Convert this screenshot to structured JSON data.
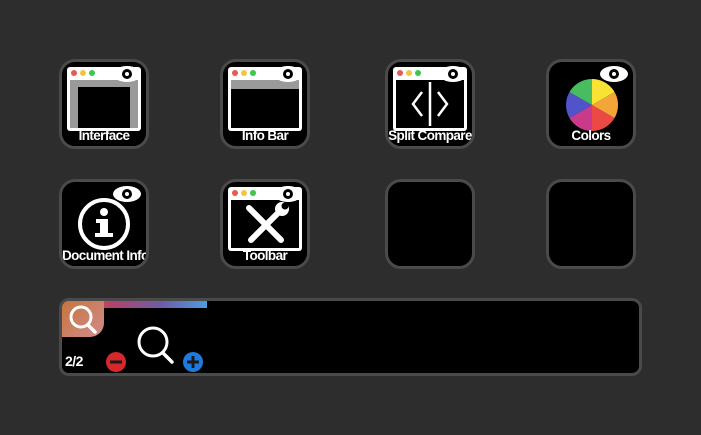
{
  "keys": [
    {
      "label": "Interface",
      "icon": "interface-window-icon"
    },
    {
      "label": "Info Bar",
      "icon": "info-bar-window-icon"
    },
    {
      "label": "Split Compare",
      "icon": "split-compare-icon"
    },
    {
      "label": "Colors",
      "icon": "color-wheel-icon"
    },
    {
      "label": "Document Info",
      "icon": "info-circle-icon"
    },
    {
      "label": "Toolbar",
      "icon": "toolbar-tools-icon"
    },
    {
      "label": "",
      "icon": ""
    },
    {
      "label": "",
      "icon": ""
    }
  ],
  "dial": {
    "page": "2/2",
    "icon": "zoom-magnifier-icon",
    "level_fraction": 0.25,
    "controls": [
      "zoom-out-button",
      "zoom-in-button"
    ]
  },
  "colors": {
    "background": "#2d2d2d",
    "key_border": "#4a4a4a",
    "traffic_red": "#e85a4f",
    "traffic_yellow": "#f2c53d",
    "traffic_green": "#3cc650",
    "minus_red": "#d6282a",
    "plus_blue": "#1f7ae0"
  }
}
